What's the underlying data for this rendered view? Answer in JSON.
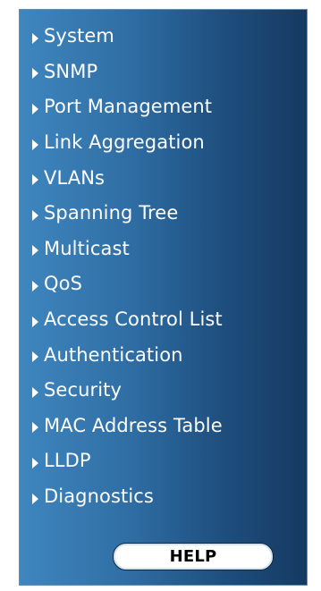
{
  "menu": {
    "items": [
      {
        "label": "System"
      },
      {
        "label": "SNMP"
      },
      {
        "label": "Port Management"
      },
      {
        "label": "Link Aggregation"
      },
      {
        "label": "VLANs"
      },
      {
        "label": "Spanning Tree"
      },
      {
        "label": "Multicast"
      },
      {
        "label": "QoS"
      },
      {
        "label": "Access Control List"
      },
      {
        "label": "Authentication"
      },
      {
        "label": "Security"
      },
      {
        "label": "MAC Address Table"
      },
      {
        "label": "LLDP"
      },
      {
        "label": "Diagnostics"
      }
    ]
  },
  "help": {
    "label": "HELP"
  },
  "icons": {
    "bullet": "triangle-right-icon"
  },
  "colors": {
    "panel_left": "#3f86bf",
    "panel_right": "#153a61",
    "text": "#ffffff",
    "help_bg": "#ffffff",
    "help_text": "#000000"
  }
}
